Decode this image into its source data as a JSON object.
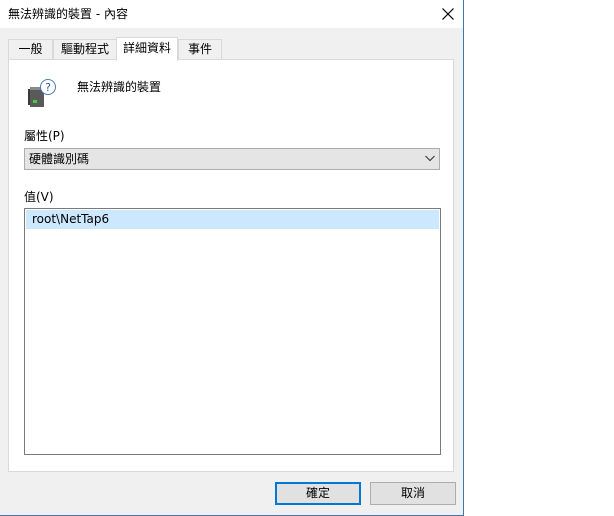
{
  "window": {
    "title": "無法辨識的裝置 - 內容",
    "close_icon": "close-icon"
  },
  "tabs": [
    {
      "label": "一般",
      "active": false
    },
    {
      "label": "驅動程式",
      "active": false
    },
    {
      "label": "詳細資料",
      "active": true
    },
    {
      "label": "事件",
      "active": false
    }
  ],
  "device": {
    "icon": "unknown-device-icon",
    "name": "無法辨識的裝置"
  },
  "property": {
    "label": "屬性(P)",
    "selected": "硬體識別碼"
  },
  "value": {
    "label": "值(V)",
    "items": [
      "root\\NetTap6"
    ]
  },
  "buttons": {
    "ok": "確定",
    "cancel": "取消"
  },
  "colors": {
    "selection": "#cce8ff",
    "accent": "#0078d7",
    "window_border": "#3c78b4"
  }
}
